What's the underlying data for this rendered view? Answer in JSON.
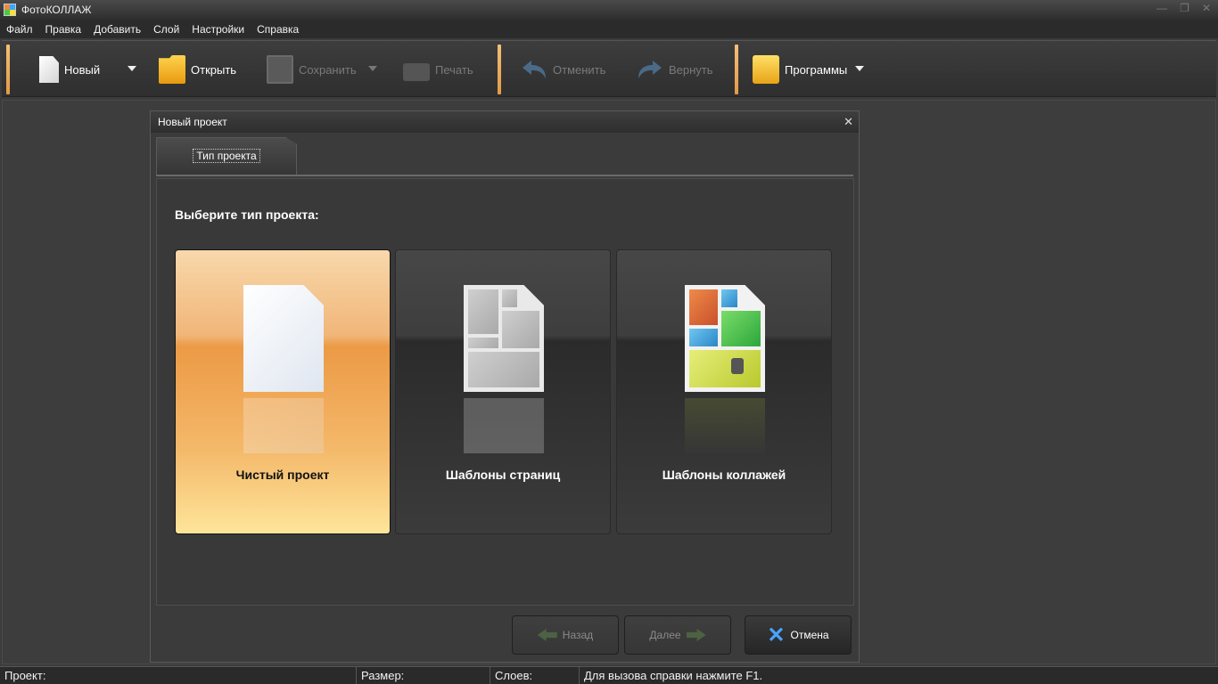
{
  "window": {
    "title": "ФотоКОЛЛАЖ"
  },
  "menu": [
    "Файл",
    "Правка",
    "Добавить",
    "Слой",
    "Настройки",
    "Справка"
  ],
  "toolbar": {
    "new": "Новый",
    "open": "Открыть",
    "save": "Сохранить",
    "print": "Печать",
    "undo": "Отменить",
    "redo": "Вернуть",
    "programs": "Программы"
  },
  "dialog": {
    "title": "Новый проект",
    "tab": "Тип проекта",
    "heading": "Выберите тип проекта:",
    "cards": [
      {
        "label": "Чистый проект",
        "selected": true
      },
      {
        "label": "Шаблоны страниц",
        "selected": false
      },
      {
        "label": "Шаблоны коллажей",
        "selected": false
      }
    ],
    "back": "Назад",
    "next": "Далее",
    "cancel": "Отмена"
  },
  "status": {
    "project": "Проект:",
    "size": "Размер:",
    "layers": "Слоев:",
    "hint": "Для вызова справки нажмите F1."
  },
  "colors": {
    "accent": "#f1b679",
    "separator": "#e49a45",
    "cancel_icon": "#4aa3ff"
  }
}
